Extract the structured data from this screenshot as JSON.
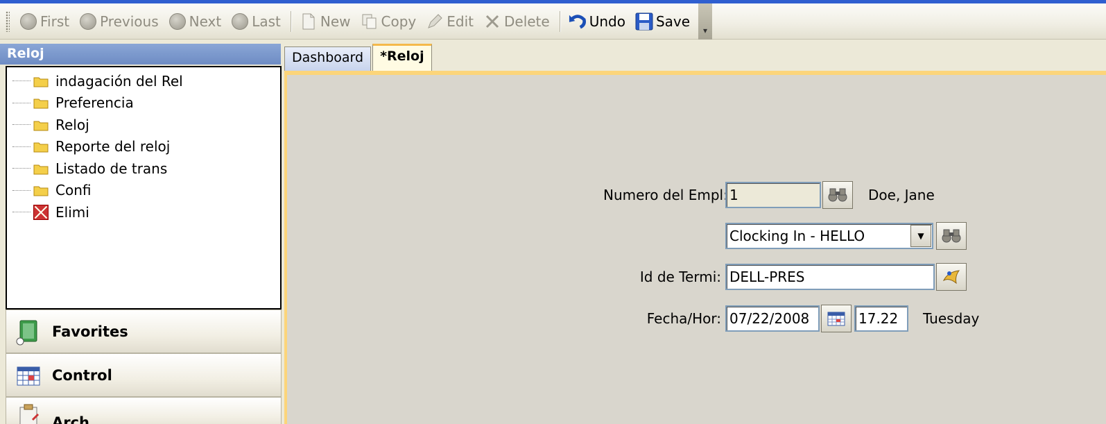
{
  "toolbar": {
    "first": "First",
    "previous": "Previous",
    "next": "Next",
    "last": "Last",
    "new": "New",
    "copy": "Copy",
    "edit": "Edit",
    "delete": "Delete",
    "undo": "Undo",
    "save": "Save"
  },
  "left_panel": {
    "title": "Reloj",
    "tree": [
      {
        "label": "indagación del Rel",
        "icon": "folder-icon"
      },
      {
        "label": "Preferencia",
        "icon": "folder-icon"
      },
      {
        "label": "Reloj",
        "icon": "folder-icon"
      },
      {
        "label": "Reporte del reloj",
        "icon": "folder-icon"
      },
      {
        "label": "Listado de trans",
        "icon": "folder-icon"
      },
      {
        "label": "Confi",
        "icon": "folder-icon"
      },
      {
        "label": "Elimi",
        "icon": "delete-x-icon"
      }
    ],
    "nav_buttons": [
      {
        "label": "Favorites",
        "icon": "notebook-icon"
      },
      {
        "label": "Control",
        "icon": "calendar-grid-icon"
      },
      {
        "label": "Arch",
        "icon": "clipboard-icon"
      }
    ]
  },
  "tabs": [
    {
      "label": "Dashboard",
      "active": false
    },
    {
      "label": "*Reloj",
      "active": true
    }
  ],
  "form": {
    "employee_label": "Numero del Empl:",
    "employee_value": "1",
    "employee_name": "Doe, Jane",
    "clock_type_value": "Clocking In - HELLO",
    "terminal_label": "Id de Termi:",
    "terminal_value": "DELL-PRES",
    "datetime_label": "Fecha/Hor:",
    "date_value": "07/22/2008",
    "time_value": "17.22",
    "weekday": "Tuesday"
  },
  "colors": {
    "titlebar_blue": "#2f5fd0",
    "panel_header": "#7b97cc",
    "tab_accent": "#fcd57a",
    "content_bg": "#d9d6cd"
  }
}
